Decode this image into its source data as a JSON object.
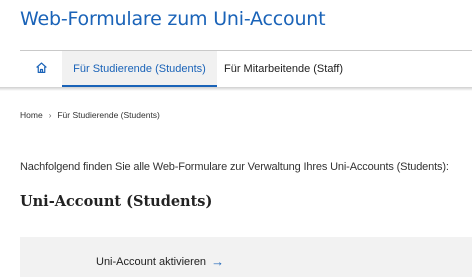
{
  "header": {
    "title": "Web-Formulare zum Uni-Account"
  },
  "nav": {
    "home_icon": "home-icon",
    "tabs": [
      {
        "label": "Für Studierende (Students)",
        "active": true
      },
      {
        "label": "Für Mitarbeitende (Staff)",
        "active": false
      }
    ]
  },
  "breadcrumb": {
    "items": [
      "Home",
      "Für Studierende (Students)"
    ],
    "separator": "›"
  },
  "main": {
    "intro": "Nachfolgend finden Sie alle Web-Formulare zur Verwaltung Ihres Uni-Accounts (Students):",
    "section_heading": "Uni-Account (Students)",
    "links": [
      {
        "label": "Uni-Account aktivieren",
        "arrow": "→"
      }
    ]
  },
  "colors": {
    "accent": "#1a63b8",
    "tab_active_bg": "#f1f1f1",
    "card_bg": "#f2f2f2"
  }
}
